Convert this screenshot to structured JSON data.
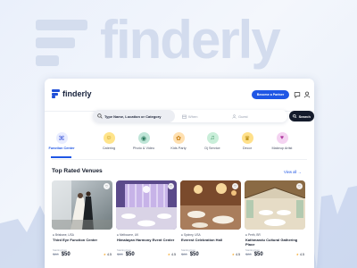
{
  "app": {
    "brand_name": "finderly",
    "background_wordmark": "finderly",
    "accent_color": "#1f56e5"
  },
  "header": {
    "partner_button_label": "Become a Partner",
    "chat_icon": "chat-icon",
    "user_icon": "user-icon"
  },
  "search": {
    "location_placeholder": "Type Name, Location or Category",
    "when_label": "When",
    "guests_label": "Guest",
    "button_label": "Search"
  },
  "categories": [
    {
      "label": "Function Center",
      "icon": "⌘",
      "color": "#e8ecff",
      "fg": "#3b56d9",
      "active": true
    },
    {
      "label": "Catering",
      "icon": "☺",
      "color": "#ffe48a",
      "fg": "#b08100"
    },
    {
      "label": "Photo & Video",
      "icon": "◉",
      "color": "#bfe5d7",
      "fg": "#2d7a5e"
    },
    {
      "label": "Kids Party",
      "icon": "✿",
      "color": "#ffe0b0",
      "fg": "#c77d12"
    },
    {
      "label": "Dj Service",
      "icon": "♫",
      "color": "#c9eed9",
      "fg": "#2e8b57"
    },
    {
      "label": "Decor",
      "icon": "♛",
      "color": "#ffe08a",
      "fg": "#b08100"
    },
    {
      "label": "Makeup Artist",
      "icon": "♥",
      "color": "#f4d3f1",
      "fg": "#b0399f"
    }
  ],
  "section": {
    "title": "Top Rated Venues",
    "view_all_label": "View all"
  },
  "venues": [
    {
      "location": "Brisbane, USA",
      "name": "Third Eye Function Center",
      "from_label": "Starting from",
      "old_price": "$80",
      "price": "$50",
      "rating": "4.5"
    },
    {
      "location": "Melbourne, UK",
      "name": "Himalayan Harmony Event Center",
      "from_label": "Starting from",
      "old_price": "$80",
      "price": "$50",
      "rating": "4.5"
    },
    {
      "location": "Sydney, USA",
      "name": "Everest Celebration Hall",
      "from_label": "Starting from",
      "old_price": "$80",
      "price": "$50",
      "rating": "4.5"
    },
    {
      "location": "Perth, BR",
      "name": "Kathmandu Cultural Gathering Place",
      "from_label": "Starting from",
      "old_price": "$80",
      "price": "$50",
      "rating": "4.5"
    }
  ]
}
